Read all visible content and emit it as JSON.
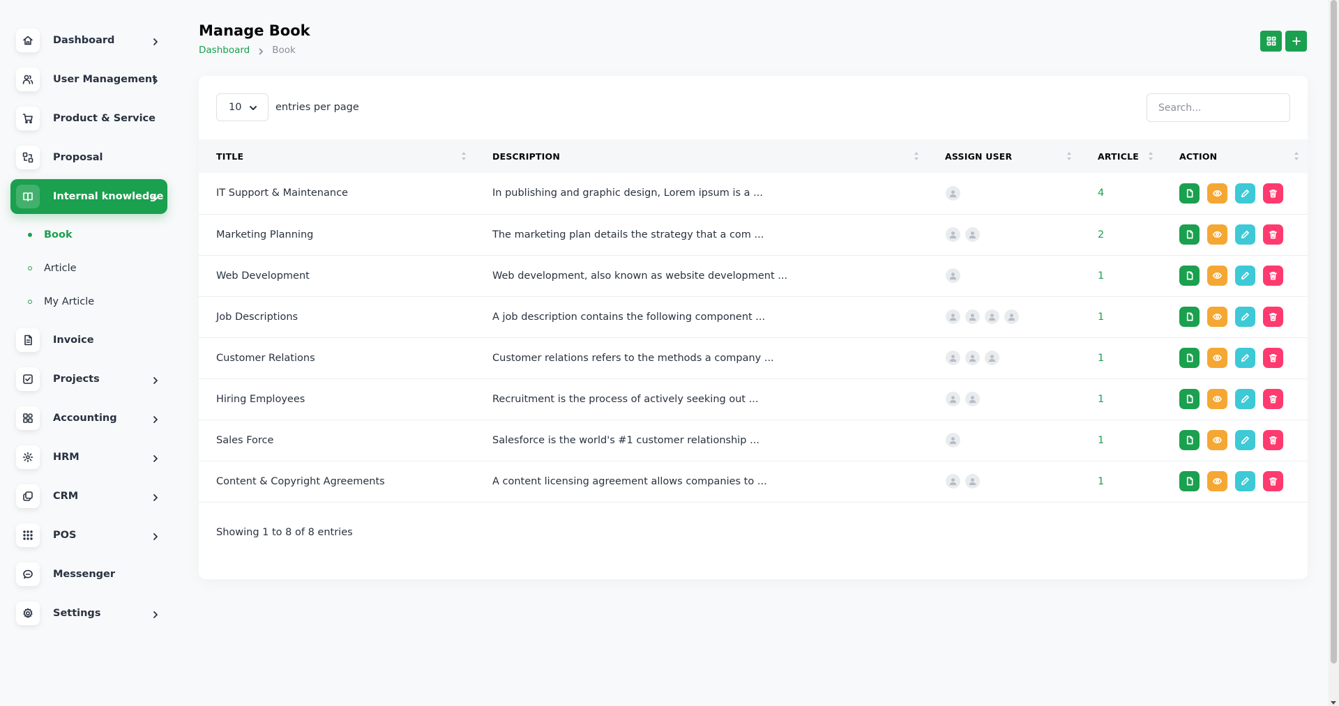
{
  "sidebar": {
    "items": [
      {
        "label": "Dashboard",
        "icon": "home-icon",
        "chevron": true
      },
      {
        "label": "User Management",
        "icon": "users-icon",
        "chevron": true
      },
      {
        "label": "Product & Service",
        "icon": "cart-icon",
        "chevron": false
      },
      {
        "label": "Proposal",
        "icon": "exchange-icon",
        "chevron": false
      },
      {
        "label": "Internal knowledge",
        "icon": "book-icon",
        "chevron": true,
        "active": true
      },
      {
        "label": "Invoice",
        "icon": "file-invoice-icon",
        "chevron": false
      },
      {
        "label": "Projects",
        "icon": "checkbox-icon",
        "chevron": true
      },
      {
        "label": "Accounting",
        "icon": "layout-grid-icon",
        "chevron": true
      },
      {
        "label": "HRM",
        "icon": "hrm-icon",
        "chevron": true
      },
      {
        "label": "CRM",
        "icon": "layers-icon",
        "chevron": true
      },
      {
        "label": "POS",
        "icon": "dots-grid-icon",
        "chevron": true
      },
      {
        "label": "Messenger",
        "icon": "message-icon",
        "chevron": false
      },
      {
        "label": "Settings",
        "icon": "gear-icon",
        "chevron": true
      }
    ],
    "submenu": [
      {
        "label": "Book",
        "current": true
      },
      {
        "label": "Article",
        "current": false
      },
      {
        "label": "My Article",
        "current": false
      }
    ]
  },
  "header": {
    "title": "Manage Book",
    "breadcrumb": {
      "home": "Dashboard",
      "current": "Book"
    }
  },
  "toolbar": {
    "grid_icon": "grid-icon",
    "add_icon": "plus-icon"
  },
  "table_controls": {
    "per_page_value": "10",
    "per_page_label": "entries per page",
    "search_placeholder": "Search..."
  },
  "table": {
    "columns": [
      "Title",
      "Description",
      "Assign User",
      "Article",
      "Action"
    ],
    "rows": [
      {
        "title": "IT Support & Maintenance",
        "description": "In publishing and graphic design, Lorem ipsum is a ...",
        "users": 1,
        "article": "4"
      },
      {
        "title": "Marketing Planning",
        "description": "The marketing plan details the strategy that a com ...",
        "users": 2,
        "article": "2"
      },
      {
        "title": "Web Development",
        "description": "Web development, also known as website development ...",
        "users": 1,
        "article": "1"
      },
      {
        "title": "Job Descriptions",
        "description": "A job description contains the following component ...",
        "users": 4,
        "article": "1"
      },
      {
        "title": "Customer Relations",
        "description": "Customer relations refers to the methods a company ...",
        "users": 3,
        "article": "1"
      },
      {
        "title": "Hiring Employees",
        "description": "Recruitment is the process of actively seeking out ...",
        "users": 2,
        "article": "1"
      },
      {
        "title": "Sales Force",
        "description": "Salesforce is the world's #1 customer relationship ...",
        "users": 1,
        "article": "1"
      },
      {
        "title": "Content & Copyright Agreements",
        "description": "A content licensing agreement allows companies to ...",
        "users": 2,
        "article": "1"
      }
    ]
  },
  "footer": {
    "showing": "Showing 1 to 8 of 8 entries"
  },
  "colors": {
    "primary": "#1aa04e",
    "warning": "#f5a733",
    "info": "#3ec9d6",
    "danger": "#ff3a6e"
  }
}
